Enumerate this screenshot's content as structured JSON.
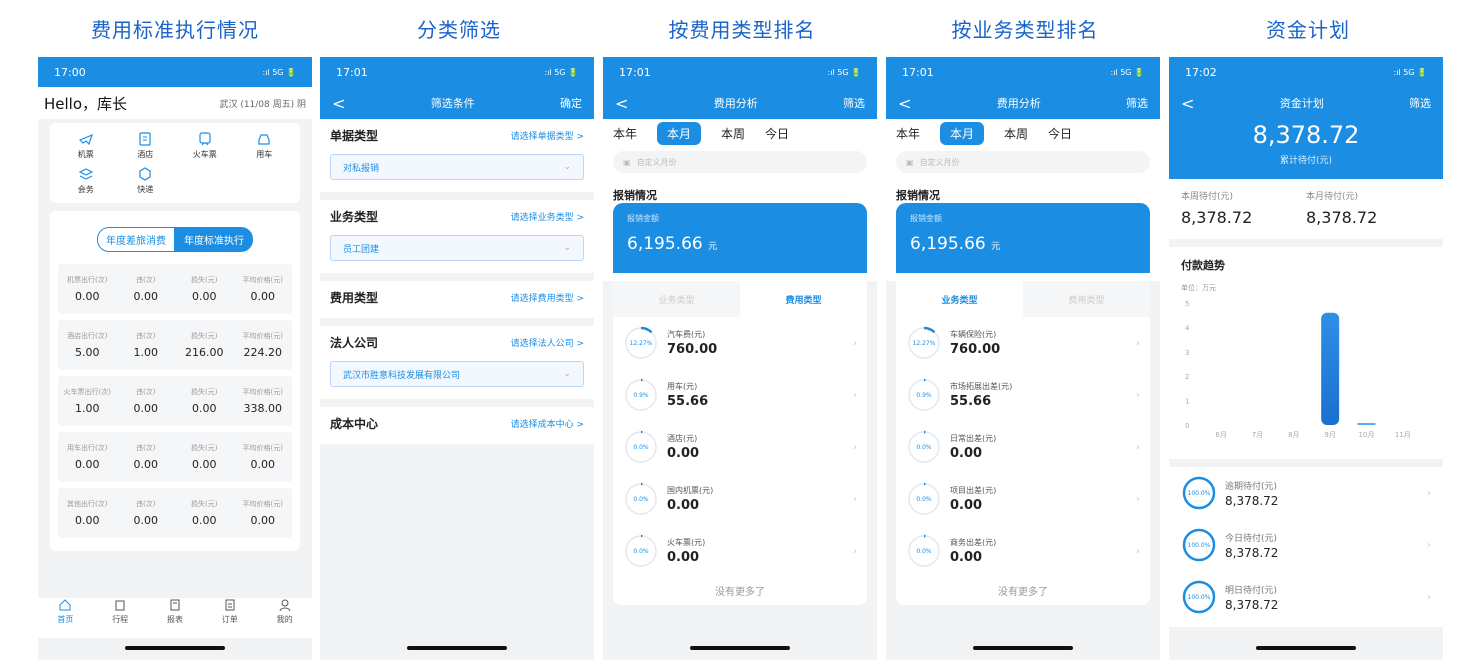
{
  "captions": [
    "费用标准执行情况",
    "分类筛选",
    "按费用类型排名",
    "按业务类型排名",
    "资金计划"
  ],
  "status": {
    "t1": "17:00",
    "t2": "17:01",
    "t3": "17:01",
    "t4": "17:01",
    "t5": "17:02",
    "right": ":ıl 5G 🔋"
  },
  "p1": {
    "hello": "Hello，库长",
    "date": "武汉 (11/08 周五) 阴",
    "quick": [
      "机票",
      "酒店",
      "火车票",
      "用车",
      "会务",
      "快递"
    ],
    "toggle": [
      "年度差旅消费",
      "年度标准执行"
    ],
    "rows": [
      {
        "labels": [
          "机票出行(次)",
          "违(次)",
          "损失(元)",
          "平均价格(元)"
        ],
        "values": [
          "0.00",
          "0.00",
          "0.00",
          "0.00"
        ]
      },
      {
        "labels": [
          "酒店出行(次)",
          "违(次)",
          "损失(元)",
          "平均价格(元)"
        ],
        "values": [
          "5.00",
          "1.00",
          "216.00",
          "224.20"
        ]
      },
      {
        "labels": [
          "火车票出行(次)",
          "违(次)",
          "损失(元)",
          "平均价格(元)"
        ],
        "values": [
          "1.00",
          "0.00",
          "0.00",
          "338.00"
        ]
      },
      {
        "labels": [
          "用车出行(次)",
          "违(次)",
          "损失(元)",
          "平均价格(元)"
        ],
        "values": [
          "0.00",
          "0.00",
          "0.00",
          "0.00"
        ]
      },
      {
        "labels": [
          "其他出行(次)",
          "违(次)",
          "损失(元)",
          "平均价格(元)"
        ],
        "values": [
          "0.00",
          "0.00",
          "0.00",
          "0.00"
        ]
      }
    ],
    "tabs": [
      "首页",
      "行程",
      "报表",
      "订单",
      "我的"
    ]
  },
  "p2": {
    "back": "<",
    "title": "筛选条件",
    "ok": "确定",
    "sections": [
      {
        "t": "单据类型",
        "s": "请选择单据类型 >",
        "v": "对私报销"
      },
      {
        "t": "业务类型",
        "s": "请选择业务类型 >",
        "v": "员工团建"
      },
      {
        "t": "费用类型",
        "s": "请选择费用类型 >",
        "v": ""
      },
      {
        "t": "法人公司",
        "s": "请选择法人公司 >",
        "v": "武汉市胜意科技发展有限公司"
      },
      {
        "t": "成本中心",
        "s": "请选择成本中心 >",
        "v": ""
      }
    ]
  },
  "analysis": {
    "title": "费用分析",
    "filter": "筛选",
    "range": [
      "本年",
      "本月",
      "本周",
      "今日"
    ],
    "date_ph": "自定义月份",
    "sec": "报销情况",
    "label": "报销金额",
    "amount": "6,195.66",
    "unit": "元",
    "tab_biz": "业务类型",
    "tab_fee": "费用类型",
    "nomore": "没有更多了"
  },
  "p3": {
    "items": [
      {
        "pct": "12.27%",
        "name": "汽车费(元)",
        "val": "760.00",
        "frac": 0.1227
      },
      {
        "pct": "0.9%",
        "name": "用车(元)",
        "val": "55.66",
        "frac": 0.009
      },
      {
        "pct": "0.0%",
        "name": "酒店(元)",
        "val": "0.00",
        "frac": 0
      },
      {
        "pct": "0.0%",
        "name": "国内机票(元)",
        "val": "0.00",
        "frac": 0
      },
      {
        "pct": "0.0%",
        "name": "火车票(元)",
        "val": "0.00",
        "frac": 0
      }
    ]
  },
  "p4": {
    "items": [
      {
        "pct": "12.27%",
        "name": "车辆保险(元)",
        "val": "760.00",
        "frac": 0.1227
      },
      {
        "pct": "0.9%",
        "name": "市场拓展出差(元)",
        "val": "55.66",
        "frac": 0.009
      },
      {
        "pct": "0.0%",
        "name": "日常出差(元)",
        "val": "0.00",
        "frac": 0
      },
      {
        "pct": "0.0%",
        "name": "项目出差(元)",
        "val": "0.00",
        "frac": 0
      },
      {
        "pct": "0.0%",
        "name": "商务出差(元)",
        "val": "0.00",
        "frac": 0
      }
    ]
  },
  "p5": {
    "title": "资金计划",
    "filter": "筛选",
    "total": "8,378.72",
    "total_label": "累计待付(元)",
    "week_label": "本周待付(元)",
    "week_val": "8,378.72",
    "month_label": "本月待付(元)",
    "month_val": "8,378.72",
    "trend": "付款趋势",
    "unit": "单位：万元",
    "plan": [
      {
        "pct": "100.0%",
        "name": "逾期待付(元)",
        "val": "8,378.72"
      },
      {
        "pct": "100.0%",
        "name": "今日待付(元)",
        "val": "8,378.72"
      },
      {
        "pct": "100.0%",
        "name": "明日待付(元)",
        "val": "8,378.72"
      }
    ]
  },
  "chart_data": {
    "type": "bar",
    "categories": [
      "6月",
      "7月",
      "8月",
      "9月",
      "10月",
      "11月"
    ],
    "values": [
      0,
      0,
      0,
      4.6,
      0.08,
      0
    ],
    "ylabel": "单位：万元",
    "ylim": [
      0,
      5
    ],
    "yticks": [
      0,
      1,
      2,
      3,
      4,
      5
    ],
    "title": "付款趋势"
  }
}
